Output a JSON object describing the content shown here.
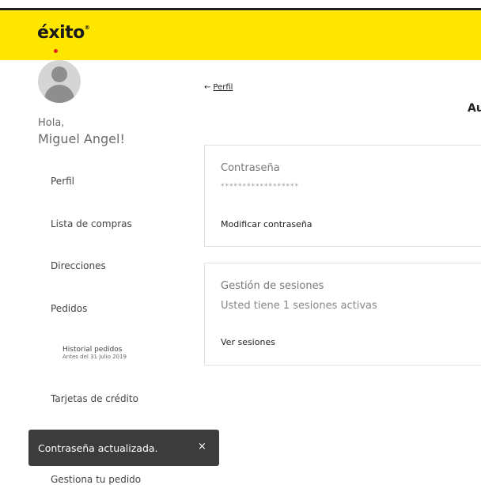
{
  "header": {
    "logo_text": "éxito",
    "logo_reg": "®",
    "bg_color": "#ffe600",
    "dot_color": "#e2231a"
  },
  "user": {
    "greeting": "Hola,",
    "name": "Miguel Angel!"
  },
  "sidebar": {
    "items": [
      {
        "label": "Perfil"
      },
      {
        "label": "Lista de compras"
      },
      {
        "label": "Direcciones"
      },
      {
        "label": "Pedidos"
      },
      {
        "label": "Historial pedidos",
        "sublabel": "Antes del 31 Julio 2019"
      },
      {
        "label": "Tarjetas de crédito"
      },
      {
        "label": "Gestiona tu pedido"
      }
    ],
    "active_marker_color": "#f39200"
  },
  "main": {
    "back_link": "Perfil",
    "back_arrow": "←",
    "partial_title": "Au",
    "password_card": {
      "label": "Contraseña",
      "masked_value": "******************",
      "action": "Modificar contraseña"
    },
    "sessions_card": {
      "label": "Gestión de sesiones",
      "status": "Usted tiene 1 sesiones activas",
      "action": "Ver sesiones"
    }
  },
  "toast": {
    "message": "Contraseña actualizada.",
    "close_glyph": "×"
  }
}
